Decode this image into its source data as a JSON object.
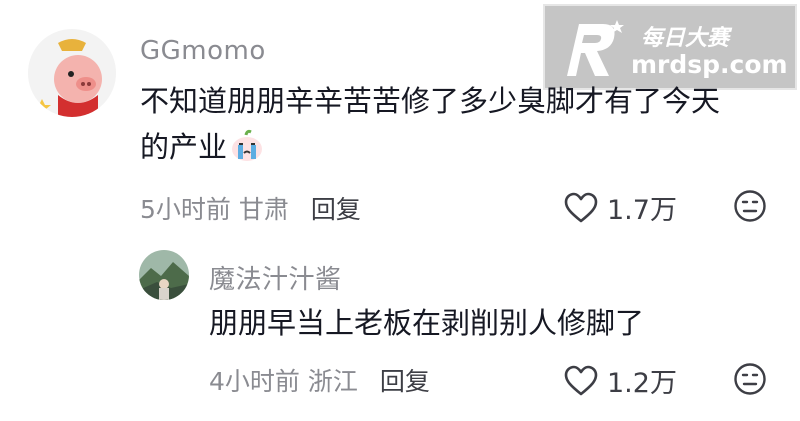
{
  "comments": [
    {
      "username": "GGmomo",
      "text_line1": "不知道朋朋辛辛苦苦修了多少臭脚才有了今天",
      "text_line2": "的产业",
      "time": "5小时前",
      "location": "甘肃",
      "reply_label": "回复",
      "like_count": "1.7万"
    },
    {
      "username": "魔法汁汁酱",
      "text": "朋朋早当上老板在剥削别人修脚了",
      "time": "4小时前",
      "location": "浙江",
      "reply_label": "回复",
      "like_count": "1.2万"
    }
  ],
  "watermark": {
    "title": "每日大赛",
    "url": "mrdsp.com"
  },
  "colors": {
    "secondary_text": "#8a8b91",
    "primary_text": "#161823"
  }
}
